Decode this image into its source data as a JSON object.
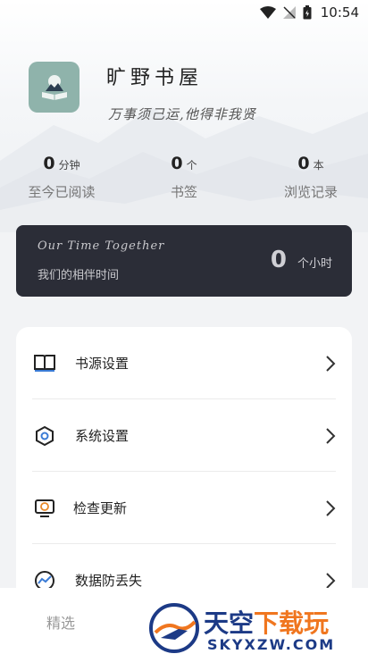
{
  "status_bar": {
    "time": "10:54"
  },
  "header": {
    "title": "旷野书屋",
    "motto": "万事须己运,他得非我贤"
  },
  "stats": [
    {
      "value": "0",
      "unit": "分钟",
      "label": "至今已阅读"
    },
    {
      "value": "0",
      "unit": "个",
      "label": "书签"
    },
    {
      "value": "0",
      "unit": "本",
      "label": "浏览记录"
    }
  ],
  "together": {
    "title_en": "Our Time Together",
    "title_cn": "我们的相伴时间",
    "hours": "0",
    "hours_unit": "个小时"
  },
  "menu": [
    {
      "label": "书源设置",
      "icon": "book-open-icon"
    },
    {
      "label": "系统设置",
      "icon": "hexagon-settings-icon"
    },
    {
      "label": "检查更新",
      "icon": "monitor-refresh-icon"
    },
    {
      "label": "数据防丢失",
      "icon": "chart-trend-icon"
    }
  ],
  "bottom_nav": {
    "tab_label": "精选"
  },
  "watermark": {
    "line1_a": "天空",
    "line1_b": "下载玩",
    "line2": "SKYXZW.COM"
  },
  "colors": {
    "card_dark": "#2b2d37",
    "logo_bg": "#8fb3ab",
    "wm_blue": "#1c3a86",
    "wm_orange": "#f0761f"
  }
}
